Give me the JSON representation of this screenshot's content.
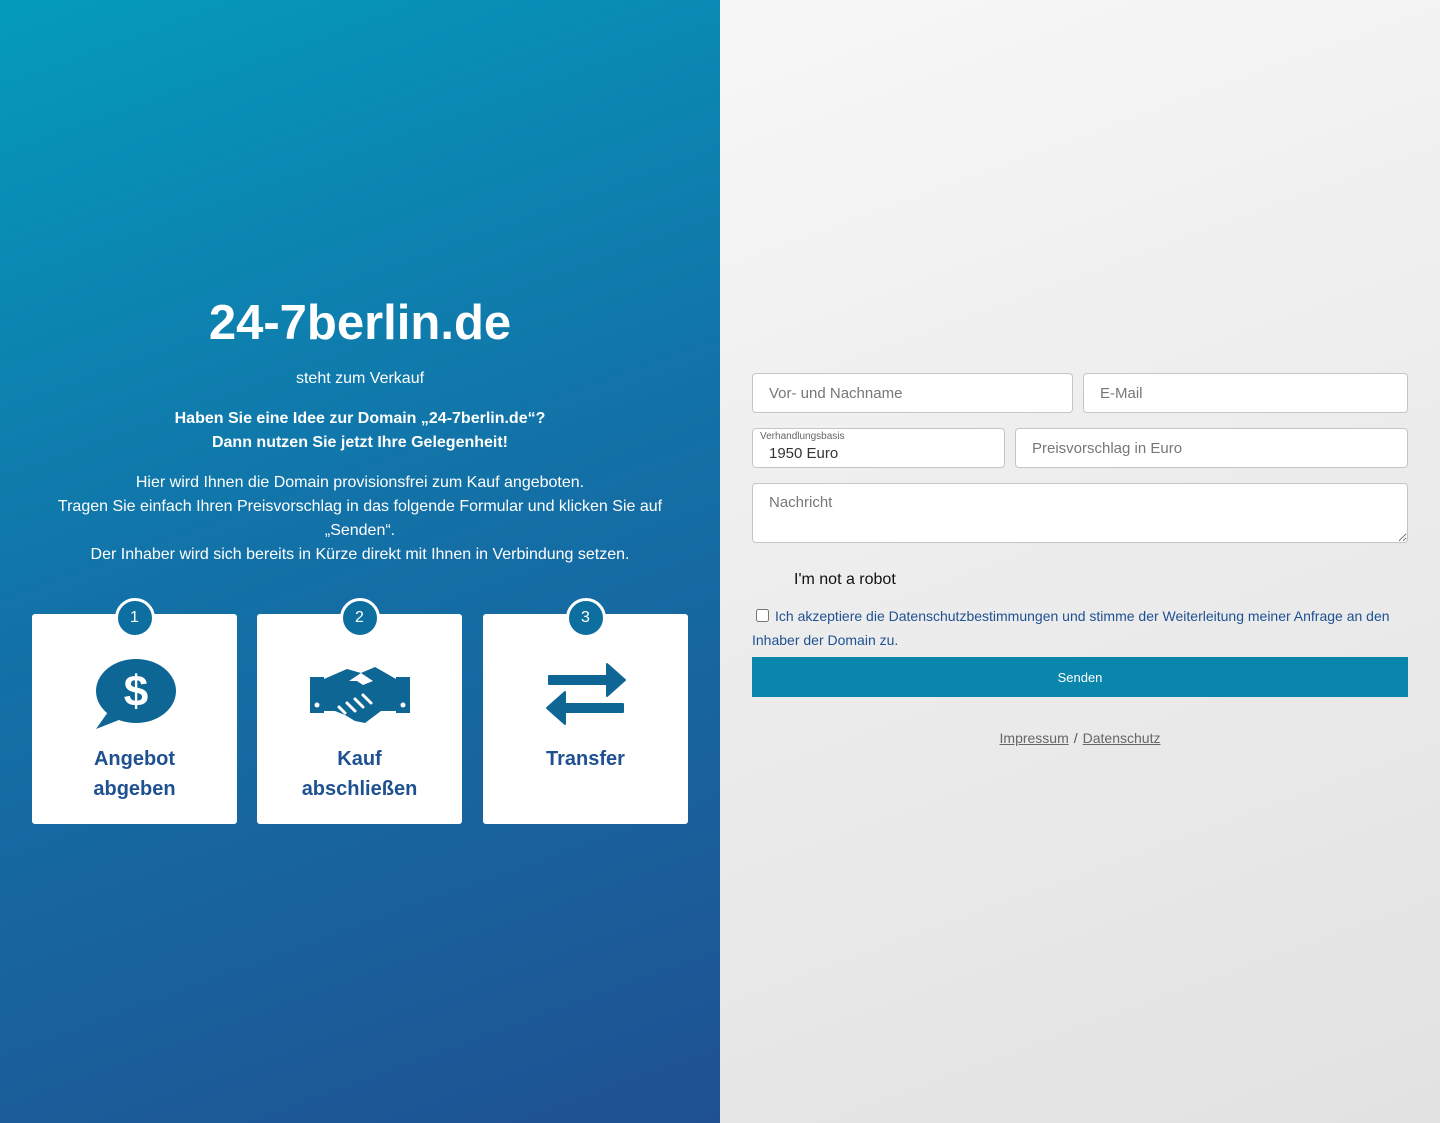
{
  "hero": {
    "domain": "24-7berlin.de",
    "subtitle": "steht zum Verkauf",
    "lead_line1": "Haben Sie eine Idee zur Domain „24-7berlin.de“?",
    "lead_line2": "Dann nutzen Sie jetzt Ihre Gelegenheit!",
    "desc_line1": "Hier wird Ihnen die Domain provisionsfrei zum Kauf angeboten.",
    "desc_line2": "Tragen Sie einfach Ihren Preisvorschlag in das folgende Formular und klicken Sie auf „Senden“.",
    "desc_line3": "Der Inhaber wird sich bereits in Kürze direkt mit Ihnen in Verbindung setzen."
  },
  "steps": [
    {
      "number": "1",
      "label": "Angebot abgeben",
      "icon": "dollar-chat-icon"
    },
    {
      "number": "2",
      "label": "Kauf abschließen",
      "icon": "handshake-icon"
    },
    {
      "number": "3",
      "label": "Transfer",
      "icon": "transfer-arrows-icon"
    }
  ],
  "form": {
    "name_placeholder": "Vor- und Nachname",
    "email_placeholder": "E-Mail",
    "price_label": "Verhandlungsbasis",
    "price_value": "1950 Euro",
    "offer_placeholder": "Preisvorschlag in Euro",
    "message_placeholder": "Nachricht",
    "captcha_label": "I'm not a robot",
    "consent_text": "Ich akzeptiere die Datenschutzbestimmungen und stimme der Weiterleitung meiner Anfrage an den Inhaber der Domain zu.",
    "submit_label": "Senden"
  },
  "footer": {
    "impressum": "Impressum",
    "separator": "/",
    "datenschutz": "Datenschutz"
  },
  "colors": {
    "gradient_start": "#049bbc",
    "gradient_end": "#1f5192",
    "button": "#0a86ad",
    "card_text": "#1f5192"
  }
}
